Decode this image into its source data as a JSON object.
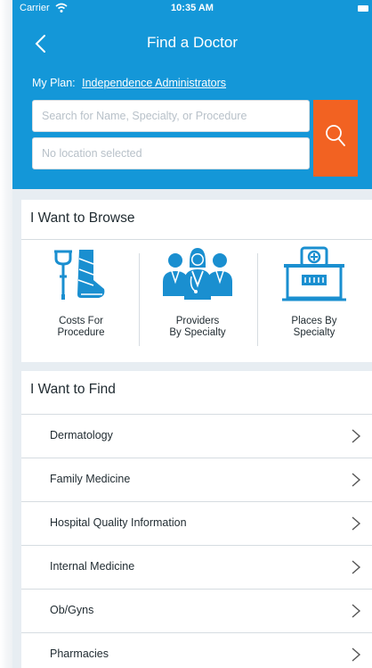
{
  "status_bar": {
    "carrier": "Carrier",
    "time": "10:35 AM"
  },
  "nav": {
    "title": "Find a Doctor"
  },
  "plan": {
    "label": "My Plan:",
    "value": "Independence Administrators"
  },
  "search": {
    "name_placeholder": "Search for Name, Specialty, or Procedure",
    "location_placeholder": "No location selected"
  },
  "browse": {
    "title": "I Want to Browse",
    "items": [
      {
        "line1": "Costs For",
        "line2": "Procedure",
        "icon": "crutch-cast-icon"
      },
      {
        "line1": "Providers",
        "line2": "By Specialty",
        "icon": "doctors-icon"
      },
      {
        "line1": "Places By",
        "line2": "Specialty",
        "icon": "hospital-icon"
      }
    ]
  },
  "find": {
    "title": "I Want to Find",
    "items": [
      {
        "label": "Dermatology"
      },
      {
        "label": "Family Medicine"
      },
      {
        "label": "Hospital Quality Information"
      },
      {
        "label": "Internal Medicine"
      },
      {
        "label": "Ob/Gyns"
      },
      {
        "label": "Pharmacies"
      }
    ]
  },
  "colors": {
    "header": "#1497d8",
    "search_button": "#f26222",
    "icon_blue": "#1a8fd0",
    "background": "#e7edf2"
  }
}
